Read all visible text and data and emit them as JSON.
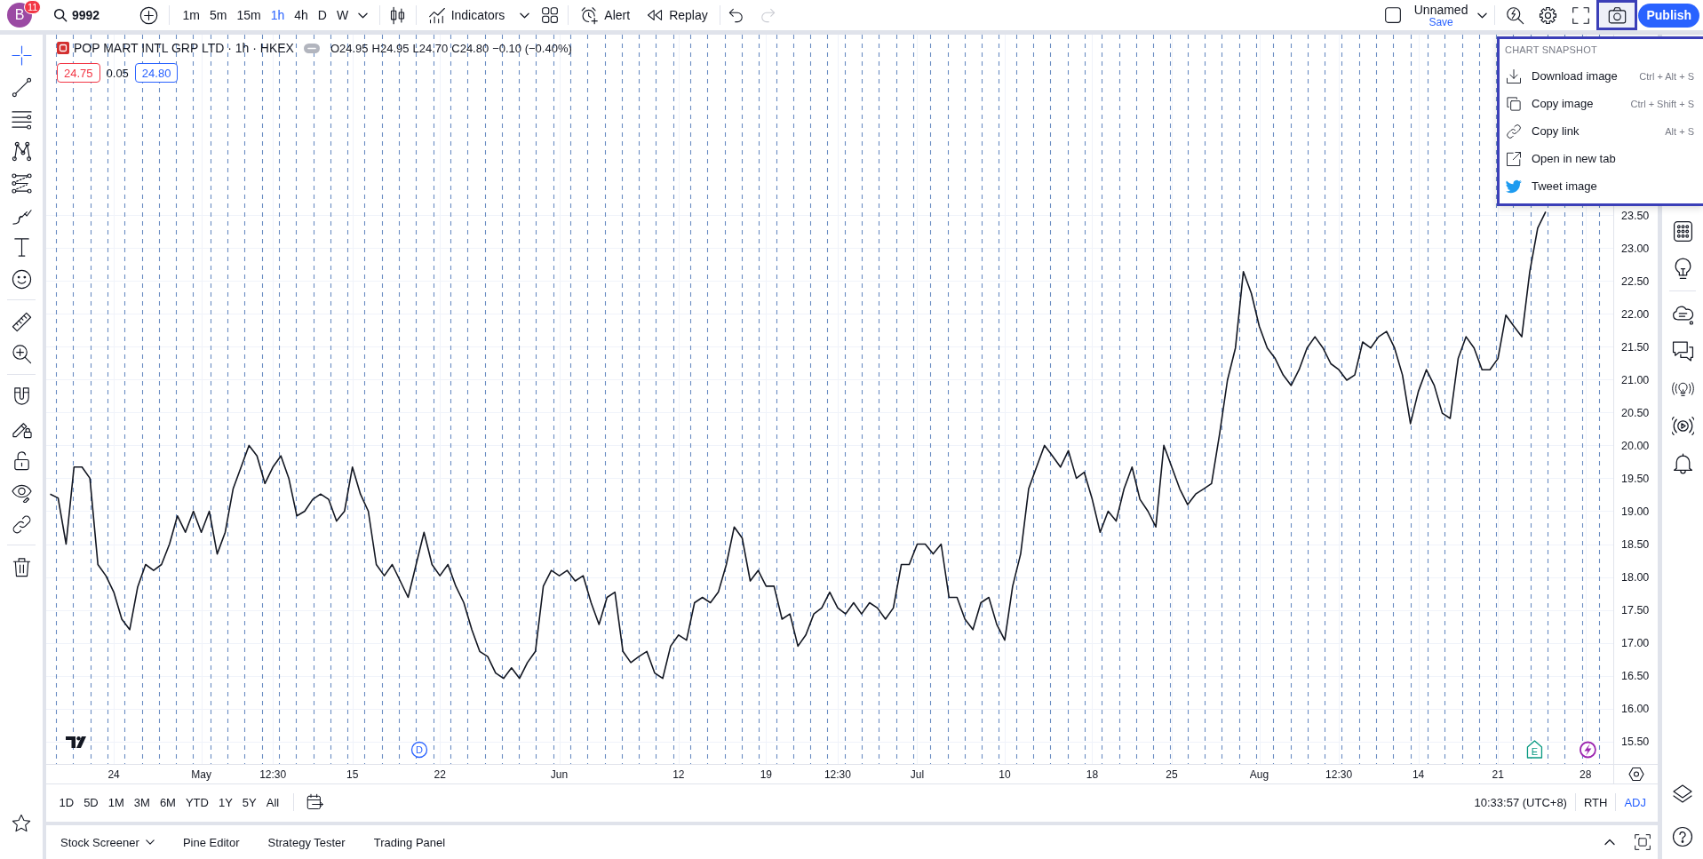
{
  "top_toolbar": {
    "avatar": {
      "letter": "B",
      "badge": "11"
    },
    "symbol_search": {
      "value": "9992"
    },
    "intervals": [
      {
        "label": "1m",
        "selected": false
      },
      {
        "label": "5m",
        "selected": false
      },
      {
        "label": "15m",
        "selected": false
      },
      {
        "label": "1h",
        "selected": true
      },
      {
        "label": "4h",
        "selected": false
      },
      {
        "label": "D",
        "selected": false
      },
      {
        "label": "W",
        "selected": false
      }
    ],
    "indicators_button": {
      "label": "Indicators"
    },
    "alert_button": {
      "label": "Alert"
    },
    "replay_button": {
      "label": "Replay"
    },
    "history": [
      {
        "kind": "undo",
        "disabled": false
      },
      {
        "kind": "redo",
        "disabled": true
      }
    ],
    "layout": {
      "name": "Unnamed",
      "save_label": "Save"
    },
    "snapshot_button": {
      "expanded": true
    },
    "publish_button": {
      "label": "Publish"
    }
  },
  "left_toolbar": {
    "groups": [
      {
        "tools": [
          {
            "kind": "crosshair",
            "selected": true
          },
          {
            "kind": "trend-line",
            "selected": false
          },
          {
            "kind": "fib-lines",
            "selected": false
          },
          {
            "kind": "pattern",
            "selected": false
          },
          {
            "kind": "projection",
            "selected": false
          },
          {
            "kind": "brush",
            "selected": false
          },
          {
            "kind": "text",
            "selected": false
          },
          {
            "kind": "emoji",
            "selected": false
          }
        ]
      },
      {
        "tools": [
          {
            "kind": "ruler",
            "selected": false
          },
          {
            "kind": "zoom-in",
            "selected": false
          }
        ]
      },
      {
        "tools": [
          {
            "kind": "magnet",
            "selected": false
          },
          {
            "kind": "drawing-lock",
            "selected": false
          },
          {
            "kind": "lock",
            "selected": false
          },
          {
            "kind": "eye",
            "selected": false
          },
          {
            "kind": "link",
            "selected": false
          }
        ]
      },
      {
        "tools": [
          {
            "kind": "trash",
            "selected": false
          }
        ]
      }
    ]
  },
  "chart": {
    "legend": {
      "symbol": "POP MART INTL GRP LTD · 1h · HKEX",
      "ohlc": [
        "O24.95",
        "H24.95",
        "L24.70",
        "C24.80"
      ],
      "change": "−0.10 (−0.40%)"
    },
    "quote": {
      "bid": "24.75",
      "spread": "0.05",
      "ask": "24.80"
    },
    "events": [
      {
        "kind": "dividend",
        "label": "D",
        "color": "#2962ff"
      },
      {
        "kind": "earnings",
        "label": "E",
        "color": "#089981"
      },
      {
        "kind": "bolt",
        "color": "#9c27b0"
      }
    ],
    "chart_data": {
      "type": "line",
      "grid": true,
      "ylim": [
        15.16,
        26.24
      ],
      "yticks": [
        {
          "value": 15.5,
          "label": "15.50"
        },
        {
          "value": 16,
          "label": "16.00"
        },
        {
          "value": 16.5,
          "label": "16.50"
        },
        {
          "value": 17,
          "label": "17.00"
        },
        {
          "value": 17.5,
          "label": "17.50"
        },
        {
          "value": 18,
          "label": "18.00"
        },
        {
          "value": 18.5,
          "label": "18.50"
        },
        {
          "value": 19,
          "label": "19.00"
        },
        {
          "value": 19.5,
          "label": "19.50"
        },
        {
          "value": 20,
          "label": "20.00"
        },
        {
          "value": 20.5,
          "label": "20.50"
        },
        {
          "value": 21,
          "label": "21.00"
        },
        {
          "value": 21.5,
          "label": "21.50"
        },
        {
          "value": 22,
          "label": "22.00"
        },
        {
          "value": 22.5,
          "label": "22.50"
        },
        {
          "value": 23,
          "label": "23.00"
        },
        {
          "value": 23.5,
          "label": "23.50"
        }
      ],
      "categories": [
        null,
        null,
        null,
        null,
        null,
        null,
        null,
        null,
        "24",
        null,
        null,
        null,
        null,
        null,
        null,
        null,
        null,
        null,
        null,
        "May",
        null,
        null,
        null,
        null,
        null,
        null,
        null,
        null,
        "12:30",
        null,
        null,
        null,
        null,
        null,
        null,
        null,
        null,
        null,
        "15",
        null,
        null,
        null,
        null,
        null,
        null,
        null,
        null,
        null,
        null,
        "22",
        null,
        null,
        null,
        null,
        null,
        null,
        null,
        null,
        null,
        null,
        null,
        null,
        null,
        null,
        "Jun",
        null,
        null,
        null,
        null,
        null,
        null,
        null,
        null,
        null,
        null,
        null,
        null,
        null,
        null,
        "12",
        null,
        null,
        null,
        null,
        null,
        null,
        null,
        null,
        null,
        null,
        "19",
        null,
        null,
        null,
        null,
        null,
        null,
        null,
        null,
        "12:30",
        null,
        null,
        null,
        null,
        null,
        null,
        null,
        null,
        null,
        "Jul",
        null,
        null,
        null,
        null,
        null,
        null,
        null,
        null,
        null,
        null,
        "10",
        null,
        null,
        null,
        null,
        null,
        null,
        null,
        null,
        null,
        null,
        "18",
        null,
        null,
        null,
        null,
        null,
        null,
        null,
        null,
        null,
        "25",
        null,
        null,
        null,
        null,
        null,
        null,
        null,
        null,
        null,
        null,
        "Aug",
        null,
        null,
        null,
        null,
        null,
        null,
        null,
        null,
        null,
        "12:30",
        null,
        null,
        null,
        null,
        null,
        null,
        null,
        null,
        null,
        "14",
        null,
        null,
        null,
        null,
        null,
        null,
        null,
        null,
        null,
        "21",
        null,
        null,
        null,
        null,
        null,
        null,
        null,
        null,
        null,
        null,
        "28",
        null,
        null,
        null
      ],
      "values": [
        19.26,
        19.2,
        18.5,
        19.67,
        19.67,
        19.5,
        18.19,
        18.02,
        17.77,
        17.36,
        17.2,
        17.85,
        18.19,
        18.1,
        18.19,
        18.5,
        18.93,
        18.68,
        19.0,
        18.68,
        19.0,
        18.35,
        18.68,
        19.34,
        19.67,
        20.0,
        19.84,
        19.42,
        19.67,
        19.84,
        19.5,
        18.93,
        19.0,
        19.18,
        19.26,
        19.18,
        18.85,
        19.0,
        19.67,
        19.26,
        19.0,
        18.19,
        18.02,
        18.19,
        17.94,
        17.69,
        18.19,
        18.68,
        18.19,
        18.02,
        18.19,
        17.86,
        17.61,
        17.2,
        16.87,
        16.79,
        16.54,
        16.46,
        16.62,
        16.46,
        16.7,
        16.87,
        17.86,
        18.1,
        18.02,
        18.1,
        17.94,
        18.02,
        17.61,
        17.28,
        17.69,
        17.77,
        16.87,
        16.7,
        16.79,
        16.87,
        16.54,
        16.46,
        16.95,
        17.12,
        17.04,
        17.61,
        17.69,
        17.61,
        17.77,
        18.19,
        18.76,
        18.59,
        17.94,
        18.1,
        17.86,
        17.86,
        17.36,
        17.44,
        16.95,
        17.12,
        17.44,
        17.53,
        17.77,
        17.53,
        17.44,
        17.61,
        17.44,
        17.61,
        17.53,
        17.36,
        17.53,
        18.19,
        18.19,
        18.5,
        18.5,
        18.35,
        18.5,
        17.69,
        17.69,
        17.36,
        17.2,
        17.61,
        17.69,
        17.28,
        17.04,
        17.86,
        18.35,
        19.34,
        19.67,
        20.0,
        19.84,
        19.67,
        19.92,
        19.5,
        19.59,
        19.18,
        18.68,
        19.0,
        18.85,
        19.34,
        19.67,
        19.18,
        19.0,
        18.76,
        20.0,
        19.67,
        19.34,
        19.1,
        19.26,
        19.34,
        19.42,
        20.17,
        20.99,
        21.48,
        22.64,
        22.31,
        21.81,
        21.48,
        21.32,
        21.07,
        20.91,
        21.15,
        21.48,
        21.65,
        21.48,
        21.24,
        21.15,
        20.99,
        21.07,
        21.57,
        21.48,
        21.65,
        21.73,
        21.48,
        21.07,
        20.33,
        20.82,
        21.15,
        20.91,
        20.49,
        20.41,
        21.32,
        21.65,
        21.48,
        21.15,
        21.15,
        21.32,
        21.98,
        21.81,
        21.65,
        22.64,
        23.3,
        23.55,
        null,
        null,
        null,
        null,
        null,
        null,
        null,
        null
      ]
    }
  },
  "range_bar": {
    "ranges": [
      "1D",
      "5D",
      "1M",
      "3M",
      "6M",
      "YTD",
      "1Y",
      "5Y",
      "All"
    ],
    "clock": "10:33:57 (UTC+8)",
    "toggles": [
      {
        "label": "RTH",
        "on": false
      },
      {
        "label": "ADJ",
        "on": true
      }
    ]
  },
  "bottom_panel": {
    "tabs": [
      {
        "label": "Stock Screener",
        "dropdown": true
      },
      {
        "label": "Pine Editor",
        "dropdown": false
      },
      {
        "label": "Strategy Tester",
        "dropdown": false
      },
      {
        "label": "Trading Panel",
        "dropdown": false
      }
    ]
  },
  "snapshot_menu": {
    "title": "CHART SNAPSHOT",
    "items": [
      {
        "kind": "download",
        "label": "Download image",
        "shortcut": "Ctrl + Alt + S"
      },
      {
        "kind": "copy",
        "label": "Copy image",
        "shortcut": "Ctrl + Shift + S"
      },
      {
        "kind": "link",
        "label": "Copy link",
        "shortcut": "Alt + S"
      },
      {
        "kind": "external",
        "label": "Open in new tab"
      },
      {
        "kind": "tweet",
        "label": "Tweet image"
      }
    ]
  }
}
